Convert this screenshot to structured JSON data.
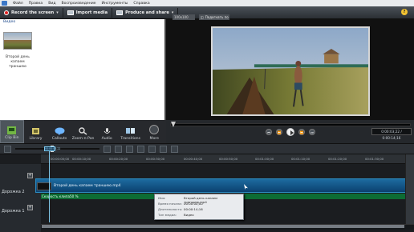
{
  "menus": [
    "Файл",
    "Правка",
    "Вид",
    "Воспроизведение",
    "Инструменты",
    "Справка"
  ],
  "toolbar": {
    "record_label": "Record the screen",
    "import_label": "Import media",
    "produce_label": "Produce and share",
    "help_label": "?"
  },
  "left_panel": {
    "section_label": "Видео",
    "clip_name": "Второй день капаем траншею"
  },
  "preview": {
    "zoom_value": "100x100",
    "fit_value": "Подогнать по"
  },
  "timecode": "0:00:03;22 / 0:00:14;16",
  "tabs": [
    {
      "label": "Clip Bin"
    },
    {
      "label": "Library"
    },
    {
      "label": "Callouts"
    },
    {
      "label": "Zoom-n-Pan"
    },
    {
      "label": "Audio"
    },
    {
      "label": "Transitions"
    },
    {
      "label": "More"
    }
  ],
  "timeline": {
    "playhead_label": "00:00:03;22",
    "ruler_labels": [
      "00:00:00;00",
      "00:00:10;00",
      "00:00:20;00",
      "00:00:30;00",
      "00:00:40;00",
      "00:00:50;00",
      "00:01:00;00",
      "00:01:10;00",
      "00:01:20;00",
      "00:01:30;00"
    ],
    "tracks": [
      {
        "label": "Дорожка 2"
      },
      {
        "label": "Дорожка 1"
      }
    ],
    "clip_label": "Второй день капаем траншею.mp4",
    "speed_label": "Скорость клипа50 %"
  },
  "tooltip": {
    "rows": [
      {
        "key": "Имя:",
        "value": "Второй день капаем траншею.mp4"
      },
      {
        "key": "Время начала:",
        "value": "00:00:00;00"
      },
      {
        "key": "Длительность:",
        "value": "00:00:14;16"
      },
      {
        "key": "Тип медиа:",
        "value": "Видео"
      }
    ]
  },
  "colors": {
    "accent": "#1d6b9f",
    "speed_bar": "#0d6c34",
    "record": "#dd2222"
  }
}
